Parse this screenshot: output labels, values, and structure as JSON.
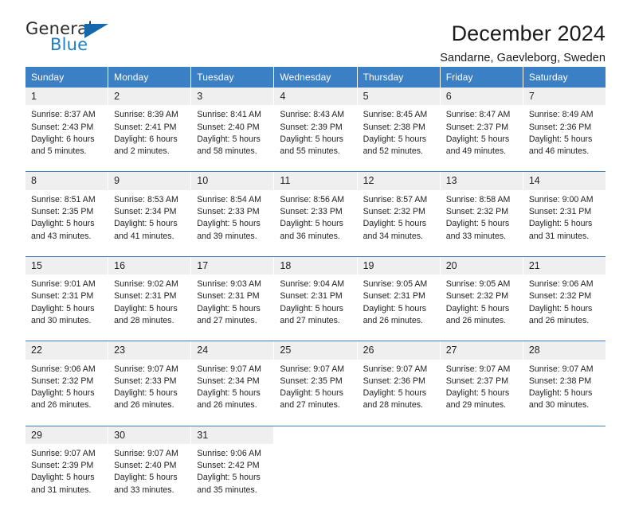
{
  "logo": {
    "primary_text": "General",
    "secondary_text": "Blue",
    "triangle_color": "#1568ad",
    "blue_color": "#1f7fc4"
  },
  "header": {
    "title": "December 2024",
    "subtitle": "Sandarne, Gaevleborg, Sweden"
  },
  "theme": {
    "header_bg": "#3b7fc4",
    "daynum_bg": "#efefef",
    "row_divider": "#3b7fc4"
  },
  "weekdays": [
    "Sunday",
    "Monday",
    "Tuesday",
    "Wednesday",
    "Thursday",
    "Friday",
    "Saturday"
  ],
  "weeks": [
    [
      {
        "day": "1",
        "sunrise": "Sunrise: 8:37 AM",
        "sunset": "Sunset: 2:43 PM",
        "daylight1": "Daylight: 6 hours",
        "daylight2": "and 5 minutes."
      },
      {
        "day": "2",
        "sunrise": "Sunrise: 8:39 AM",
        "sunset": "Sunset: 2:41 PM",
        "daylight1": "Daylight: 6 hours",
        "daylight2": "and 2 minutes."
      },
      {
        "day": "3",
        "sunrise": "Sunrise: 8:41 AM",
        "sunset": "Sunset: 2:40 PM",
        "daylight1": "Daylight: 5 hours",
        "daylight2": "and 58 minutes."
      },
      {
        "day": "4",
        "sunrise": "Sunrise: 8:43 AM",
        "sunset": "Sunset: 2:39 PM",
        "daylight1": "Daylight: 5 hours",
        "daylight2": "and 55 minutes."
      },
      {
        "day": "5",
        "sunrise": "Sunrise: 8:45 AM",
        "sunset": "Sunset: 2:38 PM",
        "daylight1": "Daylight: 5 hours",
        "daylight2": "and 52 minutes."
      },
      {
        "day": "6",
        "sunrise": "Sunrise: 8:47 AM",
        "sunset": "Sunset: 2:37 PM",
        "daylight1": "Daylight: 5 hours",
        "daylight2": "and 49 minutes."
      },
      {
        "day": "7",
        "sunrise": "Sunrise: 8:49 AM",
        "sunset": "Sunset: 2:36 PM",
        "daylight1": "Daylight: 5 hours",
        "daylight2": "and 46 minutes."
      }
    ],
    [
      {
        "day": "8",
        "sunrise": "Sunrise: 8:51 AM",
        "sunset": "Sunset: 2:35 PM",
        "daylight1": "Daylight: 5 hours",
        "daylight2": "and 43 minutes."
      },
      {
        "day": "9",
        "sunrise": "Sunrise: 8:53 AM",
        "sunset": "Sunset: 2:34 PM",
        "daylight1": "Daylight: 5 hours",
        "daylight2": "and 41 minutes."
      },
      {
        "day": "10",
        "sunrise": "Sunrise: 8:54 AM",
        "sunset": "Sunset: 2:33 PM",
        "daylight1": "Daylight: 5 hours",
        "daylight2": "and 39 minutes."
      },
      {
        "day": "11",
        "sunrise": "Sunrise: 8:56 AM",
        "sunset": "Sunset: 2:33 PM",
        "daylight1": "Daylight: 5 hours",
        "daylight2": "and 36 minutes."
      },
      {
        "day": "12",
        "sunrise": "Sunrise: 8:57 AM",
        "sunset": "Sunset: 2:32 PM",
        "daylight1": "Daylight: 5 hours",
        "daylight2": "and 34 minutes."
      },
      {
        "day": "13",
        "sunrise": "Sunrise: 8:58 AM",
        "sunset": "Sunset: 2:32 PM",
        "daylight1": "Daylight: 5 hours",
        "daylight2": "and 33 minutes."
      },
      {
        "day": "14",
        "sunrise": "Sunrise: 9:00 AM",
        "sunset": "Sunset: 2:31 PM",
        "daylight1": "Daylight: 5 hours",
        "daylight2": "and 31 minutes."
      }
    ],
    [
      {
        "day": "15",
        "sunrise": "Sunrise: 9:01 AM",
        "sunset": "Sunset: 2:31 PM",
        "daylight1": "Daylight: 5 hours",
        "daylight2": "and 30 minutes."
      },
      {
        "day": "16",
        "sunrise": "Sunrise: 9:02 AM",
        "sunset": "Sunset: 2:31 PM",
        "daylight1": "Daylight: 5 hours",
        "daylight2": "and 28 minutes."
      },
      {
        "day": "17",
        "sunrise": "Sunrise: 9:03 AM",
        "sunset": "Sunset: 2:31 PM",
        "daylight1": "Daylight: 5 hours",
        "daylight2": "and 27 minutes."
      },
      {
        "day": "18",
        "sunrise": "Sunrise: 9:04 AM",
        "sunset": "Sunset: 2:31 PM",
        "daylight1": "Daylight: 5 hours",
        "daylight2": "and 27 minutes."
      },
      {
        "day": "19",
        "sunrise": "Sunrise: 9:05 AM",
        "sunset": "Sunset: 2:31 PM",
        "daylight1": "Daylight: 5 hours",
        "daylight2": "and 26 minutes."
      },
      {
        "day": "20",
        "sunrise": "Sunrise: 9:05 AM",
        "sunset": "Sunset: 2:32 PM",
        "daylight1": "Daylight: 5 hours",
        "daylight2": "and 26 minutes."
      },
      {
        "day": "21",
        "sunrise": "Sunrise: 9:06 AM",
        "sunset": "Sunset: 2:32 PM",
        "daylight1": "Daylight: 5 hours",
        "daylight2": "and 26 minutes."
      }
    ],
    [
      {
        "day": "22",
        "sunrise": "Sunrise: 9:06 AM",
        "sunset": "Sunset: 2:32 PM",
        "daylight1": "Daylight: 5 hours",
        "daylight2": "and 26 minutes."
      },
      {
        "day": "23",
        "sunrise": "Sunrise: 9:07 AM",
        "sunset": "Sunset: 2:33 PM",
        "daylight1": "Daylight: 5 hours",
        "daylight2": "and 26 minutes."
      },
      {
        "day": "24",
        "sunrise": "Sunrise: 9:07 AM",
        "sunset": "Sunset: 2:34 PM",
        "daylight1": "Daylight: 5 hours",
        "daylight2": "and 26 minutes."
      },
      {
        "day": "25",
        "sunrise": "Sunrise: 9:07 AM",
        "sunset": "Sunset: 2:35 PM",
        "daylight1": "Daylight: 5 hours",
        "daylight2": "and 27 minutes."
      },
      {
        "day": "26",
        "sunrise": "Sunrise: 9:07 AM",
        "sunset": "Sunset: 2:36 PM",
        "daylight1": "Daylight: 5 hours",
        "daylight2": "and 28 minutes."
      },
      {
        "day": "27",
        "sunrise": "Sunrise: 9:07 AM",
        "sunset": "Sunset: 2:37 PM",
        "daylight1": "Daylight: 5 hours",
        "daylight2": "and 29 minutes."
      },
      {
        "day": "28",
        "sunrise": "Sunrise: 9:07 AM",
        "sunset": "Sunset: 2:38 PM",
        "daylight1": "Daylight: 5 hours",
        "daylight2": "and 30 minutes."
      }
    ],
    [
      {
        "day": "29",
        "sunrise": "Sunrise: 9:07 AM",
        "sunset": "Sunset: 2:39 PM",
        "daylight1": "Daylight: 5 hours",
        "daylight2": "and 31 minutes."
      },
      {
        "day": "30",
        "sunrise": "Sunrise: 9:07 AM",
        "sunset": "Sunset: 2:40 PM",
        "daylight1": "Daylight: 5 hours",
        "daylight2": "and 33 minutes."
      },
      {
        "day": "31",
        "sunrise": "Sunrise: 9:06 AM",
        "sunset": "Sunset: 2:42 PM",
        "daylight1": "Daylight: 5 hours",
        "daylight2": "and 35 minutes."
      },
      {
        "day": "",
        "sunrise": "",
        "sunset": "",
        "daylight1": "",
        "daylight2": ""
      },
      {
        "day": "",
        "sunrise": "",
        "sunset": "",
        "daylight1": "",
        "daylight2": ""
      },
      {
        "day": "",
        "sunrise": "",
        "sunset": "",
        "daylight1": "",
        "daylight2": ""
      },
      {
        "day": "",
        "sunrise": "",
        "sunset": "",
        "daylight1": "",
        "daylight2": ""
      }
    ]
  ]
}
